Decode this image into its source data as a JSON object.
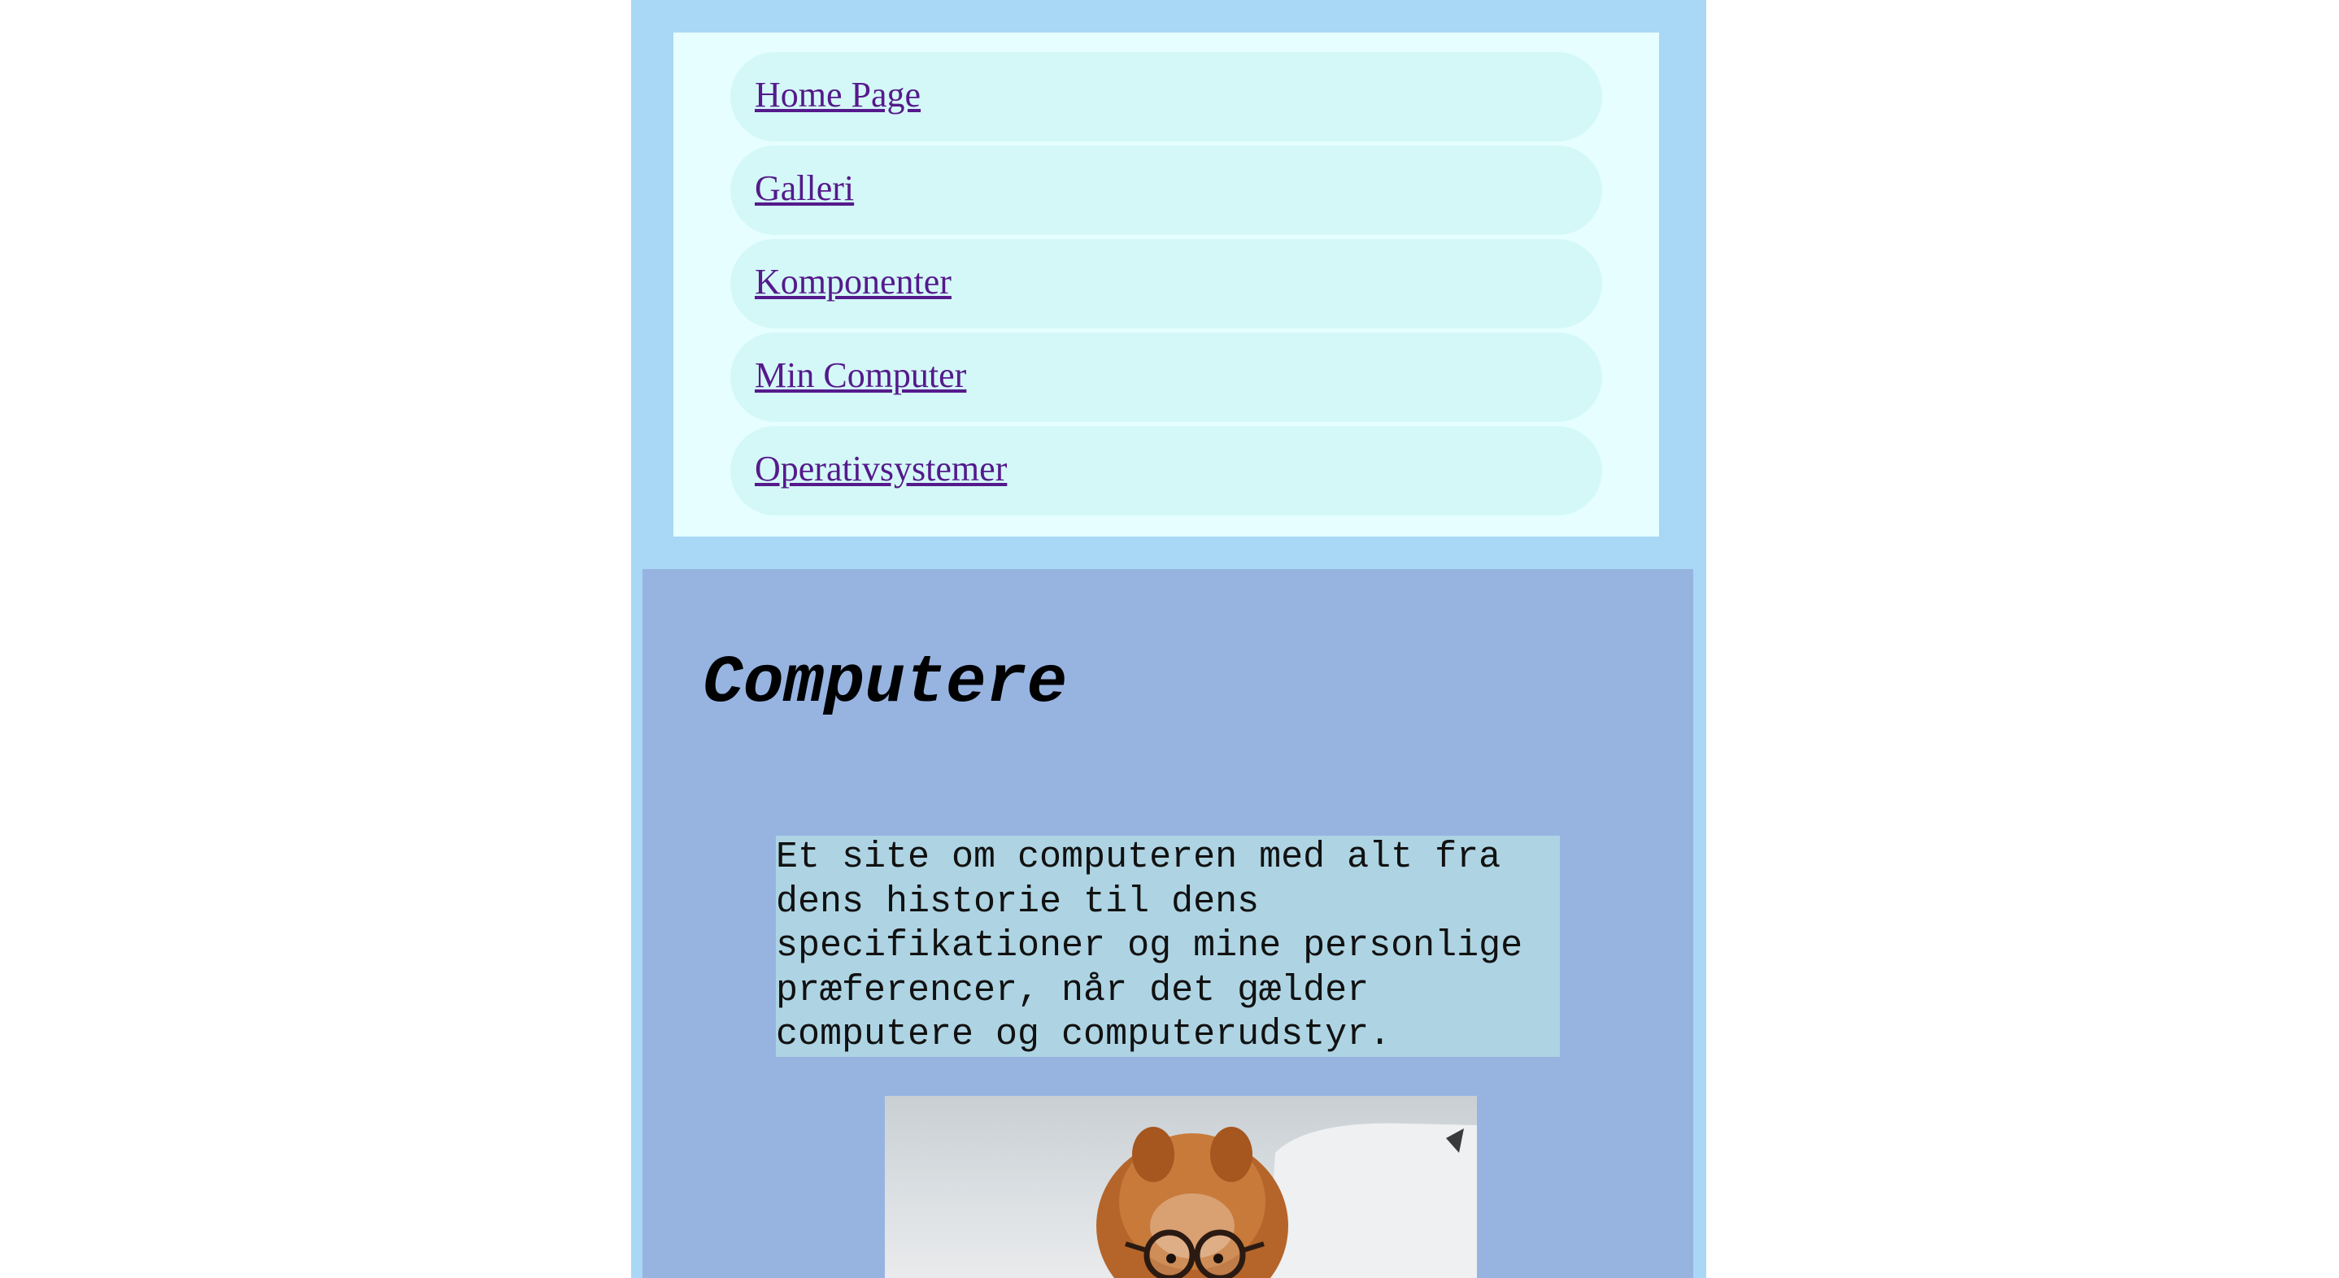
{
  "navigation": {
    "items": [
      {
        "label": "Home Page"
      },
      {
        "label": "Galleri"
      },
      {
        "label": "Komponenter"
      },
      {
        "label": "Min Computer"
      },
      {
        "label": "Operativsystemer"
      }
    ]
  },
  "main": {
    "title": "Computere",
    "intro": "Et site om computeren med alt fra\ndens historie til dens\nspecifikationer og mine personlige\npræferencer, når det gælder\ncomputere og computerudstyr.",
    "image": {
      "description_icon": "dog-with-glasses-photo"
    }
  },
  "colors": {
    "page_background": "#ffffff",
    "column_background": "#a9d7f6",
    "nav_panel_background": "#e6feff",
    "nav_item_background": "#d4f8f8",
    "link_color": "#551a8b",
    "main_background": "#97b4e1",
    "intro_background": "#aed4e3"
  }
}
